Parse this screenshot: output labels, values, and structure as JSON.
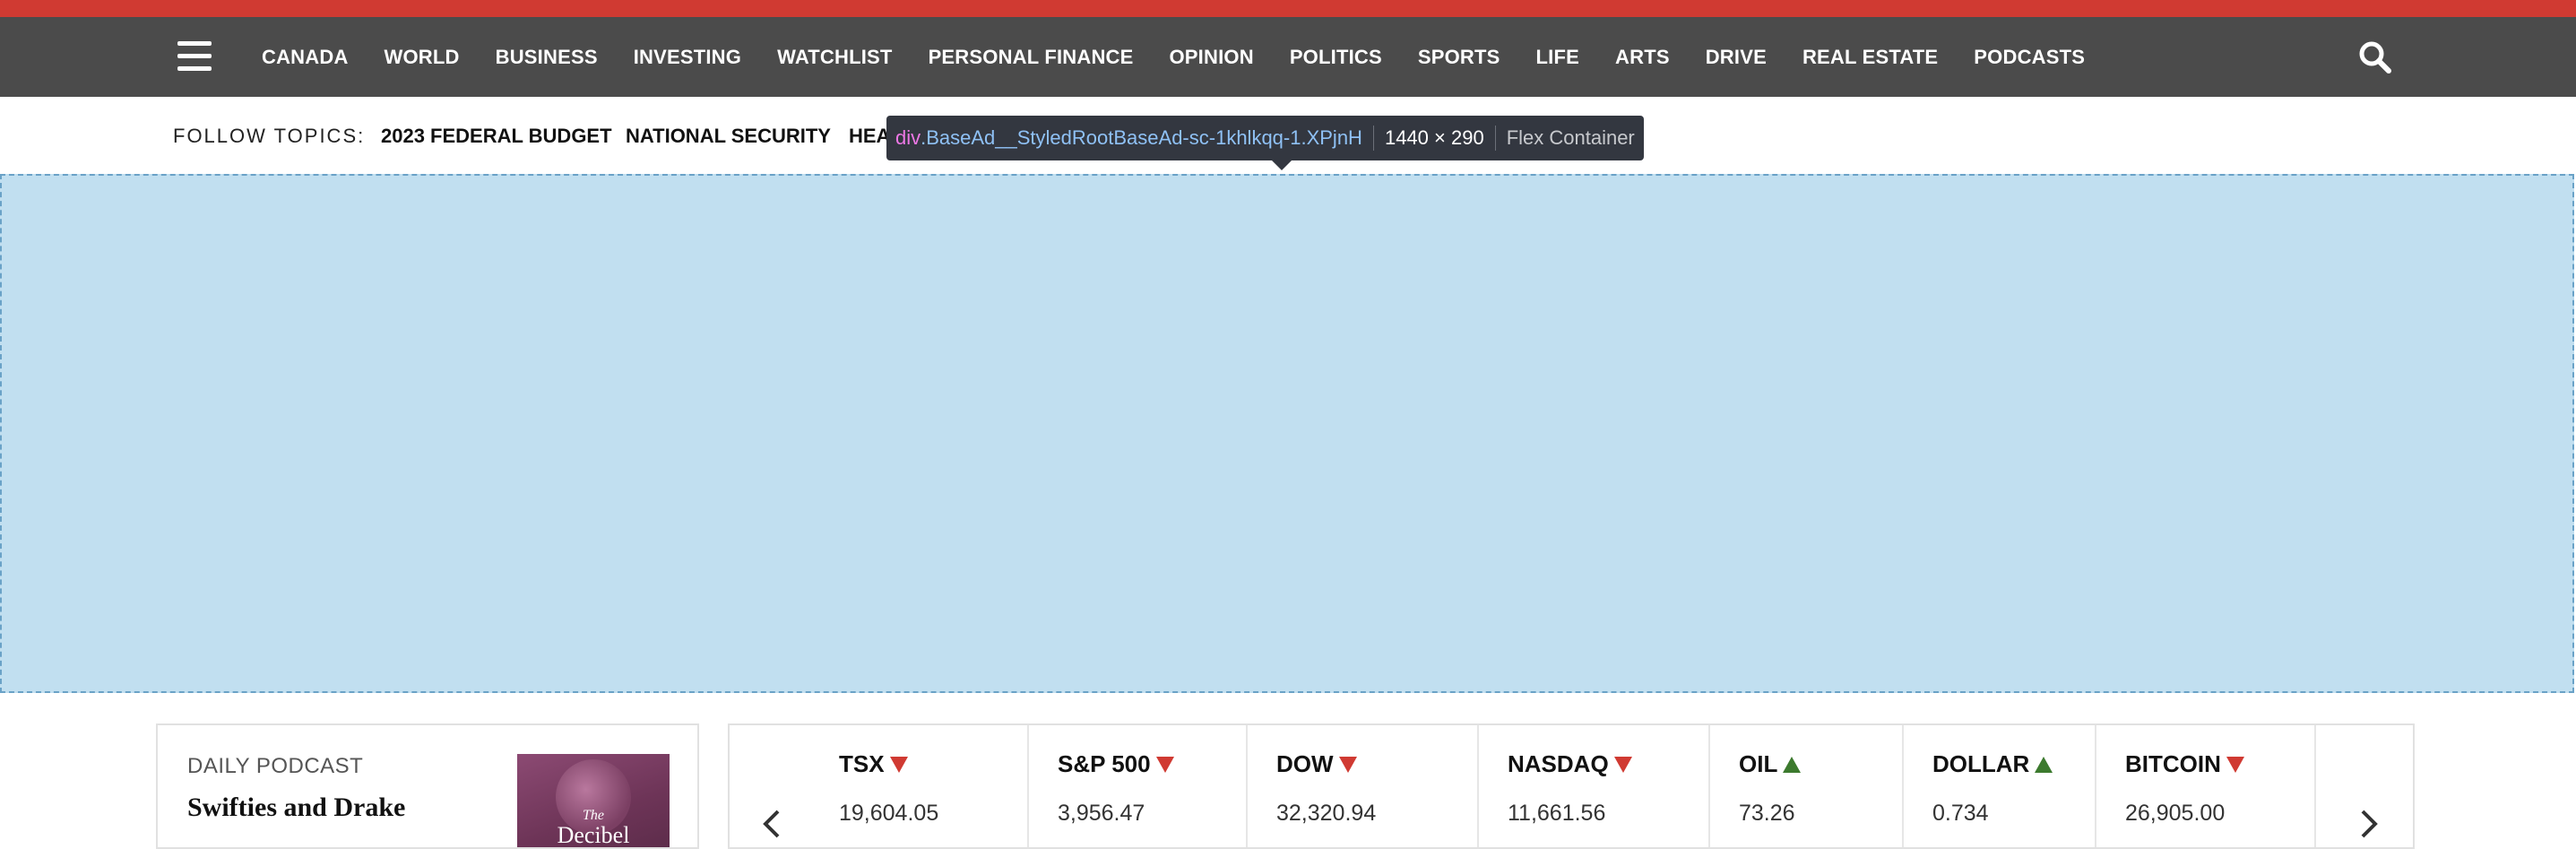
{
  "nav": {
    "items": [
      "CANADA",
      "WORLD",
      "BUSINESS",
      "INVESTING",
      "WATCHLIST",
      "PERSONAL FINANCE",
      "OPINION",
      "POLITICS",
      "SPORTS",
      "LIFE",
      "ARTS",
      "DRIVE",
      "REAL ESTATE",
      "PODCASTS"
    ]
  },
  "topics": {
    "label": "FOLLOW TOPICS:",
    "links": [
      "2023 FEDERAL BUDGET",
      "NATIONAL SECURITY",
      "HEA"
    ]
  },
  "devtools": {
    "tag": "div",
    "class_name": ".BaseAd__StyledRootBaseAd-sc-1khlkqq-1.XPjnH",
    "dimensions": "1440 × 290",
    "kind": "Flex Container"
  },
  "podcast": {
    "label": "DAILY PODCAST",
    "title": "Swifties and Drake",
    "art_the": "The",
    "art_name": "Decibel"
  },
  "tickers": [
    {
      "name": "TSX",
      "direction": "down",
      "value": "19,604.05"
    },
    {
      "name": "S&P 500",
      "direction": "down",
      "value": "3,956.47"
    },
    {
      "name": "DOW",
      "direction": "down",
      "value": "32,320.94"
    },
    {
      "name": "NASDAQ",
      "direction": "down",
      "value": "11,661.56"
    },
    {
      "name": "OIL",
      "direction": "up",
      "value": "73.26"
    },
    {
      "name": "DOLLAR",
      "direction": "up",
      "value": "0.734"
    },
    {
      "name": "BITCOIN",
      "direction": "down",
      "value": "26,905.00"
    }
  ],
  "colors": {
    "brand_red": "#d03a32",
    "nav_bg": "#4b4b4b",
    "highlight": "#c1dff0",
    "down": "#d03a32",
    "up": "#3c7a2e"
  }
}
